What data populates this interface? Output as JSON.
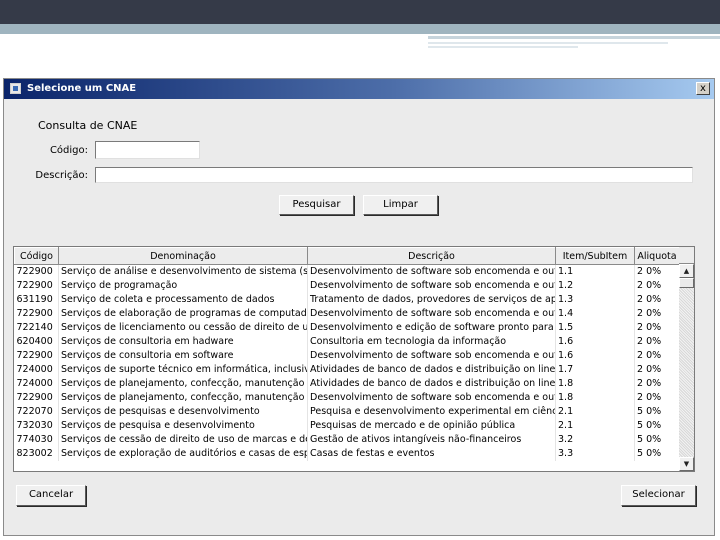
{
  "window": {
    "title": "Selecione um CNAE",
    "close_glyph": "x"
  },
  "form": {
    "section_title": "Consulta de CNAE",
    "codigo_label": "Código:",
    "codigo_value": "",
    "descricao_label": "Descrição:",
    "descricao_value": ""
  },
  "buttons": {
    "search": "Pesquisar",
    "clear": "Limpar",
    "cancel": "Cancelar",
    "select": "Selecionar"
  },
  "table": {
    "columns": [
      "Código",
      "Denominação",
      "Descrição",
      "Item/SubItem",
      "Aliquota"
    ],
    "rows": [
      [
        "722900",
        "Serviço de análise e desenvolvimento de sistema (s...",
        "Desenvolvimento de software sob encomenda e out...",
        "1.1",
        "2 0%"
      ],
      [
        "722900",
        "Serviço de programação",
        "Desenvolvimento de software sob encomenda e out...",
        "1.2",
        "2 0%"
      ],
      [
        "631190",
        "Serviço de coleta e processamento de dados",
        "Tratamento de dados, provedores de serviços de ap...",
        "1.3",
        "2 0%"
      ],
      [
        "722900",
        "Serviços de elaboração de programas de computado...",
        "Desenvolvimento de software sob encomenda e out...",
        "1.4",
        "2 0%"
      ],
      [
        "722140",
        "Serviços de licenciamento ou cessão de direito de us...",
        "Desenvolvimento e edição de software pronto para ...",
        "1.5",
        "2 0%"
      ],
      [
        "620400",
        "Serviços de consultoria em hadware",
        "Consultoria em tecnologia da informação",
        "1.6",
        "2 0%"
      ],
      [
        "722900",
        "Serviços de consultoria em software",
        "Desenvolvimento de software sob encomenda e out...",
        "1.6",
        "2 0%"
      ],
      [
        "724000",
        "Serviços de suporte técnico em informática, inclusive...",
        "Atividades de banco de dados e distribuição on line ...",
        "1.7",
        "2 0%"
      ],
      [
        "724000",
        "Serviços de planejamento, confecção, manutenção ...",
        "Atividades de banco de dados e distribuição on line ...",
        "1.8",
        "2 0%"
      ],
      [
        "722900",
        "Serviços de planejamento, confecção, manutenção ...",
        "Desenvolvimento de software sob encomenda e out...",
        "1.8",
        "2 0%"
      ],
      [
        "722070",
        "Serviços de pesquisas e desenvolvimento",
        "Pesquisa e desenvolvimento experimental em ciência...",
        "2.1",
        "5 0%"
      ],
      [
        "732030",
        "Serviços de pesquisa e desenvolvimento",
        "Pesquisas de mercado e de opinião pública",
        "2.1",
        "5 0%"
      ],
      [
        "774030",
        "Serviços de cessão de direito de uso de marcas e de...",
        "Gestão de ativos intangíveis não-financeiros",
        "3.2",
        "5 0%"
      ],
      [
        "823002",
        "Serviços de exploração de auditórios e casas de esp...",
        "Casas de festas e eventos",
        "3.3",
        "5 0%"
      ]
    ]
  },
  "scrollbar": {
    "up_glyph": "▲",
    "down_glyph": "▼"
  }
}
